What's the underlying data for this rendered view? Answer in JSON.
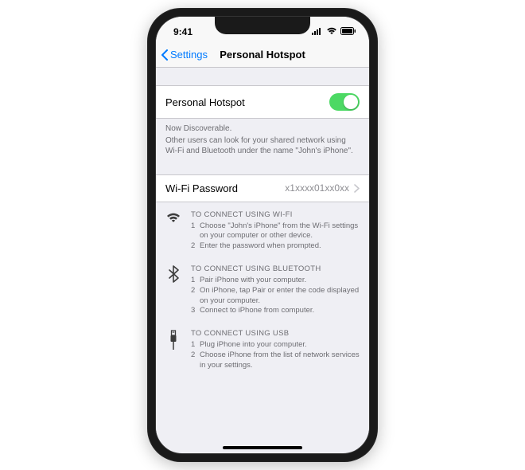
{
  "status": {
    "time": "9:41"
  },
  "nav": {
    "back": "Settings",
    "title": "Personal Hotspot"
  },
  "toggle_row": {
    "label": "Personal Hotspot",
    "on": true
  },
  "footer": {
    "line1": "Now Discoverable.",
    "line2": "Other users can look for your shared network using Wi-Fi and Bluetooth under the name \"John's iPhone\"."
  },
  "password_row": {
    "label": "Wi-Fi Password",
    "value": "x1xxxx01xx0xx"
  },
  "instructions": [
    {
      "icon": "wifi",
      "title": "TO CONNECT USING WI-FI",
      "steps": [
        "Choose \"John's iPhone\" from the Wi-Fi settings on your computer or other device.",
        "Enter the password when prompted."
      ]
    },
    {
      "icon": "bluetooth",
      "title": "TO CONNECT USING BLUETOOTH",
      "steps": [
        "Pair iPhone with your computer.",
        "On iPhone, tap Pair or enter the code displayed on your computer.",
        "Connect to iPhone from computer."
      ]
    },
    {
      "icon": "usb",
      "title": "TO CONNECT USING USB",
      "steps": [
        "Plug iPhone into your computer.",
        "Choose iPhone from the list of network services in your settings."
      ]
    }
  ]
}
